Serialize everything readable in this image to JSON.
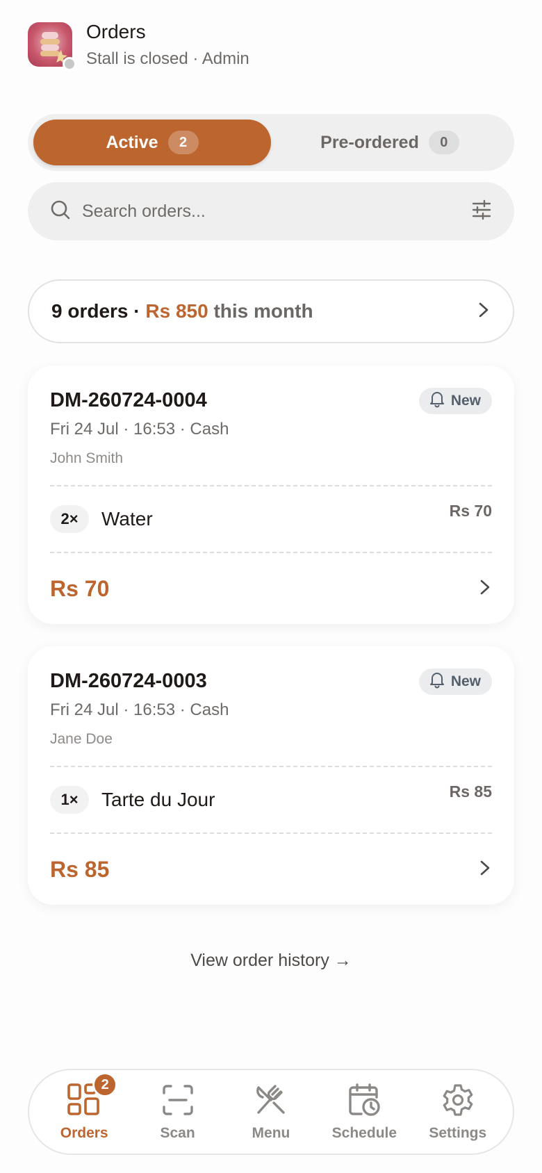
{
  "header": {
    "title": "Orders",
    "subtitle": "Stall is closed · Admin",
    "avatar_icon": "stall-logo-icon",
    "status_color": "#c7c7c7"
  },
  "tabs": [
    {
      "label": "Active",
      "count": "2",
      "active": true
    },
    {
      "label": "Pre-ordered",
      "count": "0",
      "active": false
    }
  ],
  "search": {
    "placeholder": "Search orders..."
  },
  "summary": {
    "count_text": "9 orders ·",
    "amount": "Rs 850",
    "suffix": "this month"
  },
  "orders": [
    {
      "id": "DM-260724-0004",
      "meta": "Fri 24 Jul · 16:53 · Cash",
      "customer": "John Smith",
      "badge": "New",
      "items": [
        {
          "qty": "2×",
          "name": "Water",
          "price": "Rs 70"
        }
      ],
      "total": "Rs 70"
    },
    {
      "id": "DM-260724-0003",
      "meta": "Fri 24 Jul · 16:53 · Cash",
      "customer": "Jane Doe",
      "badge": "New",
      "items": [
        {
          "qty": "1×",
          "name": "Tarte du Jour",
          "price": "Rs 85"
        }
      ],
      "total": "Rs 85"
    }
  ],
  "history_link": "View order history →",
  "nav": {
    "items": [
      {
        "label": "Orders",
        "icon": "orders-grid-icon",
        "active": true,
        "badge": "2"
      },
      {
        "label": "Scan",
        "icon": "scan-icon",
        "active": false
      },
      {
        "label": "Menu",
        "icon": "utensils-crossed-icon",
        "active": false
      },
      {
        "label": "Schedule",
        "icon": "calendar-clock-icon",
        "active": false
      },
      {
        "label": "Settings",
        "icon": "gear-icon",
        "active": false
      }
    ]
  },
  "colors": {
    "accent": "#bd652f",
    "background": "#fdfdfd"
  }
}
